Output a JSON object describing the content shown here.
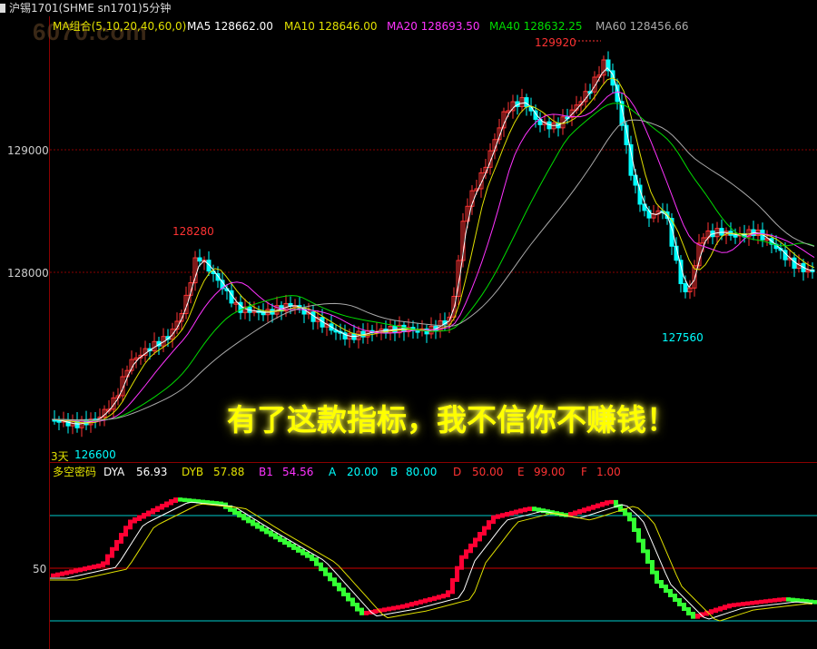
{
  "header": {
    "title": "沪锡1701(SHME sn1701)5分钟"
  },
  "watermark": "6070.com",
  "ma_legend": {
    "group": {
      "label": "MA组合(5,10,20,40,60,0)",
      "color": "#e0e000"
    },
    "ma5": {
      "label": "MA5 128662.00",
      "color": "#ffffff"
    },
    "ma10": {
      "label": "MA10 128646.00",
      "color": "#e0e000"
    },
    "ma20": {
      "label": "MA20 128693.50",
      "color": "#ff33ff"
    },
    "ma40": {
      "label": "MA40 128632.25",
      "color": "#00dd00"
    },
    "ma60": {
      "label": "MA60 128456.66",
      "color": "#aaaaaa"
    }
  },
  "price_axis": {
    "labels": [
      "129000",
      "128000"
    ]
  },
  "annotations": {
    "high_main": "129920",
    "high_left": "128280",
    "low_right": "127560",
    "low_left": "126600",
    "days": "3天"
  },
  "headline": "有了这款指标，我不信你不赚钱！",
  "sub_indicator": {
    "name": "多空密码",
    "dya_label": "DYA",
    "dya_value": "56.93",
    "dyb_label": "DYB",
    "dyb_value": "57.88",
    "b1_label": "B1",
    "b1_value": "54.56",
    "a_label": "A",
    "a_value": "20.00",
    "b_label": "B",
    "b_value": "80.00",
    "d_label": "D",
    "d_value": "50.00",
    "e_label": "E",
    "e_value": "99.00",
    "f_label": "F",
    "f_value": "1.00",
    "axis_label": "50"
  },
  "colors": {
    "up": "#ff3333",
    "down": "#00ffff",
    "grid": "#8a0000",
    "bar_up": "#ff0033",
    "bar_down": "#33ff33"
  }
}
